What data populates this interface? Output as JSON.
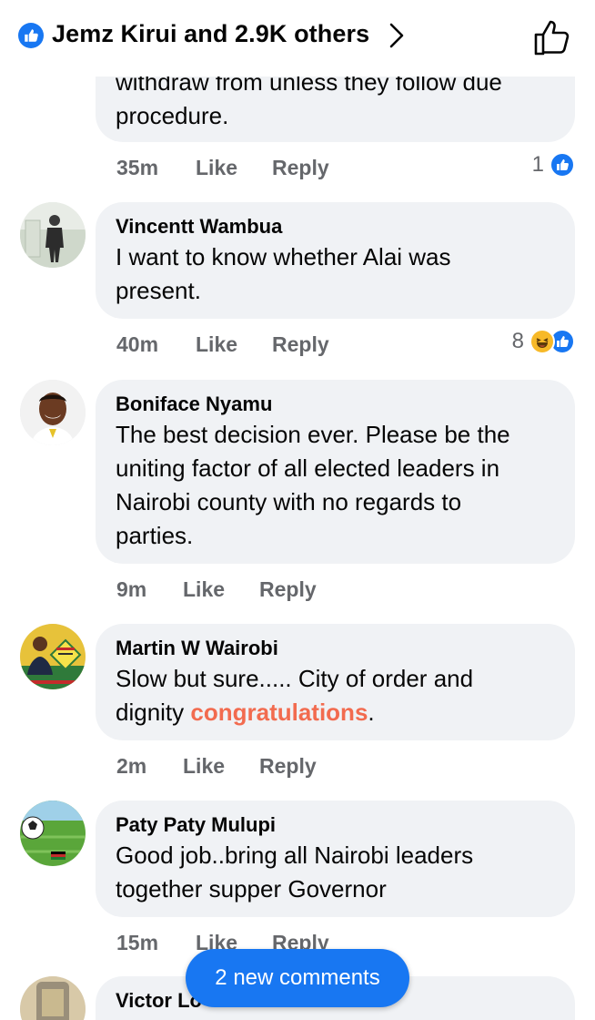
{
  "header": {
    "reactors_label": "Jemz Kirui and 2.9K others"
  },
  "comments": [
    {
      "author": "",
      "text_lines": [
        "withdraw from unless they follow due",
        "procedure."
      ],
      "time": "35m",
      "like": "Like",
      "reply": "Reply",
      "reaction_count": "1",
      "reactions": [
        "like"
      ]
    },
    {
      "author": "Vincentt Wambua",
      "text_lines": [
        "I want to know whether Alai was",
        "present."
      ],
      "time": "40m",
      "like": "Like",
      "reply": "Reply",
      "reaction_count": "8",
      "reactions": [
        "haha",
        "like"
      ]
    },
    {
      "author": "Boniface Nyamu",
      "text_lines": [
        "The best decision ever. Please be the",
        "uniting factor of all elected leaders in",
        "Nairobi county with no regards to",
        "parties."
      ],
      "time": "9m",
      "like": "Like",
      "reply": "Reply"
    },
    {
      "author": "Martin W Wairobi",
      "text_line1": "Slow but sure..... City of order and",
      "text_line2_prefix": "dignity ",
      "text_line2_highlight": "congratulations",
      "text_line2_suffix": ".",
      "time": "2m",
      "like": "Like",
      "reply": "Reply"
    },
    {
      "author": "Paty Paty Mulupi",
      "text_lines": [
        "Good job..bring all Nairobi leaders",
        "together supper Governor"
      ],
      "time": "15m",
      "like": "Like",
      "reply": "Reply"
    },
    {
      "author": "Victor Lo"
    }
  ],
  "new_comments_button": "2 new comments",
  "colors": {
    "facebook_blue": "#1877f2",
    "bubble_bg": "#f0f2f5",
    "meta_grey": "#65676b",
    "highlight_orange": "#f26b4f"
  },
  "icons": [
    "like-badge-icon",
    "chevron-right-icon",
    "thumbs-up-outline-icon",
    "like-reaction-icon",
    "haha-reaction-icon"
  ]
}
